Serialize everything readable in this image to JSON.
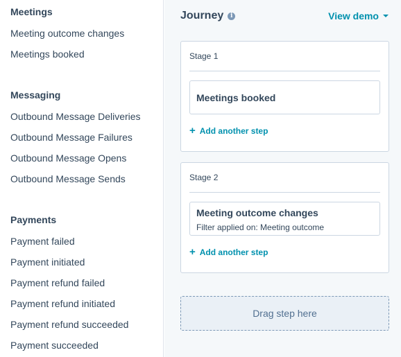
{
  "sidebar": {
    "sections": [
      {
        "title": "Meetings",
        "items": [
          "Meeting outcome changes",
          "Meetings booked"
        ]
      },
      {
        "title": "Messaging",
        "items": [
          "Outbound Message Deliveries",
          "Outbound Message Failures",
          "Outbound Message Opens",
          "Outbound Message Sends"
        ]
      },
      {
        "title": "Payments",
        "items": [
          "Payment failed",
          "Payment initiated",
          "Payment refund failed",
          "Payment refund initiated",
          "Payment refund succeeded",
          "Payment succeeded"
        ]
      }
    ]
  },
  "journey": {
    "title": "Journey",
    "info_icon": "i",
    "view_demo_label": "View demo",
    "stages": [
      {
        "title": "Stage 1",
        "step_title": "Meetings booked",
        "add_step_label": "Add another step"
      },
      {
        "title": "Stage 2",
        "step_title": "Meeting outcome changes",
        "step_filter": "Filter applied on: Meeting outcome",
        "add_step_label": "Add another step"
      }
    ],
    "drop_zone_label": "Drag step here"
  },
  "colors": {
    "accent": "#0091ae",
    "text": "#33475b",
    "border": "#cbd6e2",
    "canvas": "#f5f8fa"
  },
  "icons": {
    "info": "info-icon",
    "caret": "chevron-down-icon",
    "plus": "plus-icon"
  }
}
